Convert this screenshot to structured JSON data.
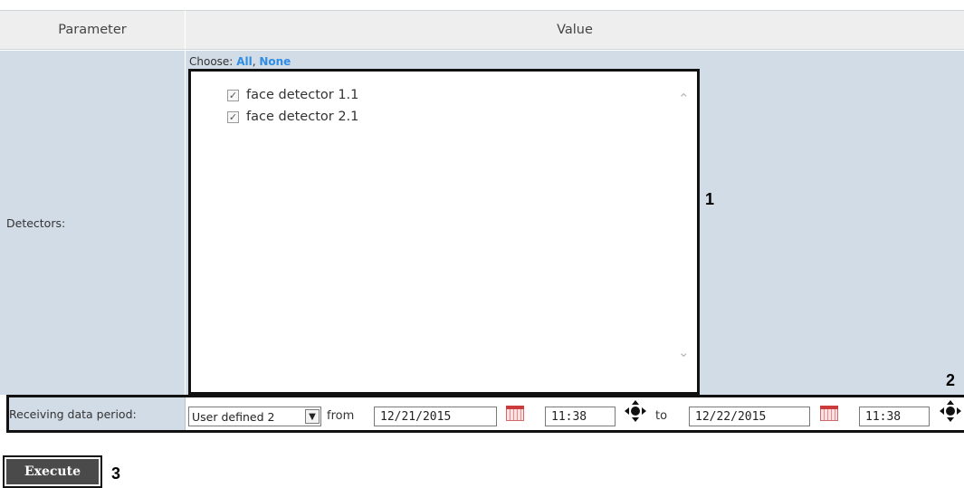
{
  "table": {
    "header_parameter": "Parameter",
    "header_value": "Value"
  },
  "detectors": {
    "label": "Detectors:",
    "choose_prefix": "Choose:",
    "choose_all": "All",
    "choose_separator": ", ",
    "choose_none": "None",
    "items": [
      {
        "label": "face detector 1.1",
        "checked": true
      },
      {
        "label": "face detector 2.1",
        "checked": true
      }
    ]
  },
  "period": {
    "label": "Receiving data period:",
    "selected_option": "User defined 2",
    "from_label": "from",
    "from_date": "12/21/2015",
    "from_time": "11:38",
    "to_label": "to",
    "to_date": "12/22/2015",
    "to_time": "11:38"
  },
  "actions": {
    "execute_label": "Execute"
  },
  "callouts": {
    "one": "1",
    "two": "2",
    "three": "3"
  },
  "icons": {
    "checkbox": "checkmark-icon",
    "scroll_up": "chevron-up-icon",
    "scroll_down": "chevron-down-icon",
    "calendar": "calendar-icon",
    "move": "move-arrows-icon",
    "dropdown": "chevron-down-icon"
  },
  "colors": {
    "row_background": "#d2dce7",
    "header_background": "#eeeeee",
    "link_color": "#2f8de4",
    "button_background": "#4a4a4a"
  }
}
